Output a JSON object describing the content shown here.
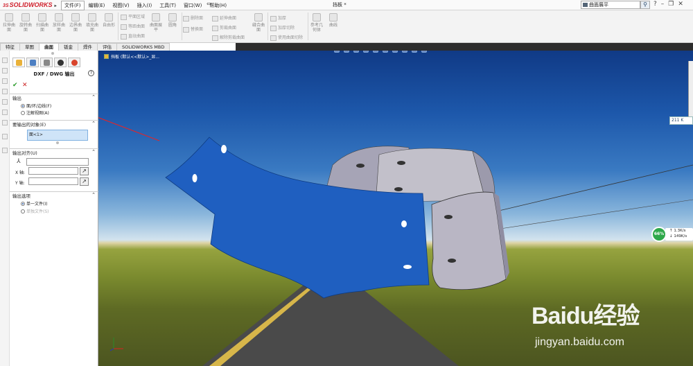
{
  "app": {
    "logo_text": "SOLIDWORKS",
    "logo_prefix": "3S",
    "document_title": "挡板 *"
  },
  "menu": {
    "items": [
      "文件(F)",
      "编辑(E)",
      "视图(V)",
      "插入(I)",
      "工具(T)",
      "窗口(W)",
      "帮助(H)"
    ]
  },
  "search": {
    "value": "曲面展平"
  },
  "ribbon": {
    "big_buttons": [
      "拉伸曲面",
      "旋转曲面",
      "扫描曲面",
      "放样曲面",
      "边界曲面",
      "填充曲面",
      "自由形"
    ],
    "small_group1": [
      "平面区域",
      "等距曲面",
      "直纹曲面"
    ],
    "big_buttons2": [
      "曲面展平",
      "圆角"
    ],
    "small_group2": [
      "删除面",
      "替换面",
      "延伸曲面",
      "剪裁曲面",
      "解除剪裁曲面",
      "缝合曲面"
    ],
    "small_group3": [
      "加厚",
      "加厚切除",
      "使用曲面切除"
    ],
    "big_buttons3": [
      "参考几何体",
      "曲线"
    ]
  },
  "tabs": [
    "特征",
    "草图",
    "曲面",
    "钣金",
    "焊件",
    "评估",
    "SOLIDWORKS MBD"
  ],
  "active_tab": "曲面",
  "breadcrumb": {
    "text": "挡板 (默认<<默认>_显..."
  },
  "property_manager": {
    "title": "DXF / DWG 输出",
    "output_section": {
      "label": "输出",
      "options": [
        "面/环/边线(F)",
        "注解视图(A)"
      ]
    },
    "entities_section": {
      "label": "要输出的对象(E)",
      "selected": "面<1>"
    },
    "align_section": {
      "label": "输出对齐(U)",
      "x_label": "X 轴:",
      "y_label": "Y 轴:"
    },
    "options_section": {
      "label": "输出选项",
      "options": [
        "单一文件(I)",
        "单独文件(S)"
      ]
    }
  },
  "network": {
    "percent": "66%",
    "up": "1.3K/s",
    "down": "149K/s"
  },
  "right_tag": "211 K",
  "watermark": {
    "logo": "Baidu经验",
    "url": "jingyan.baidu.com"
  },
  "colors": {
    "flat_part": "#1f5fc0",
    "curved_part": "#b7b4c2",
    "annotation_arrow": "#e0262a"
  }
}
